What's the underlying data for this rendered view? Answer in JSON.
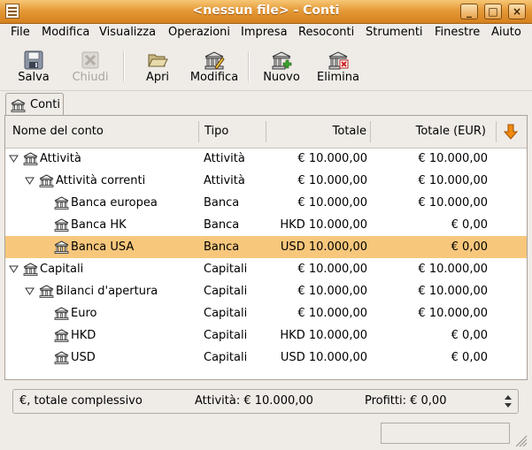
{
  "window": {
    "title": "<nessun file> - Conti",
    "controls": [
      "_",
      "□",
      "×"
    ]
  },
  "menubar": {
    "items": [
      "File",
      "Modifica",
      "Visualizza",
      "Operazioni",
      "Impresa",
      "Resoconti",
      "Strumenti",
      "Finestre",
      "Aiuto"
    ]
  },
  "toolbar": {
    "salva": "Salva",
    "chiudi": "Chiudi",
    "apri": "Apri",
    "modifica": "Modifica",
    "nuovo": "Nuovo",
    "elimina": "Elimina"
  },
  "tab": {
    "label": "Conti"
  },
  "columns": {
    "name": "Nome del conto",
    "type": "Tipo",
    "total": "Totale",
    "total_eur": "Totale (EUR)"
  },
  "rows": [
    {
      "name": "Attività",
      "type": "Attività",
      "total": "€ 10.000,00",
      "total_eur": "€ 10.000,00",
      "expanded": true
    },
    {
      "name": "Attività correnti",
      "type": "Attività",
      "total": "€ 10.000,00",
      "total_eur": "€ 10.000,00",
      "expanded": true
    },
    {
      "name": "Banca europea",
      "type": "Banca",
      "total": "€ 10.000,00",
      "total_eur": "€ 10.000,00"
    },
    {
      "name": "Banca HK",
      "type": "Banca",
      "total": "HKD 10.000,00",
      "total_eur": "€ 0,00"
    },
    {
      "name": "Banca USA",
      "type": "Banca",
      "total": "USD 10.000,00",
      "total_eur": "€ 0,00",
      "selected": true
    },
    {
      "name": "Capitali",
      "type": "Capitali",
      "total": "€ 10.000,00",
      "total_eur": "€ 10.000,00",
      "expanded": true
    },
    {
      "name": "Bilanci d'apertura",
      "type": "Capitali",
      "total": "€ 10.000,00",
      "total_eur": "€ 10.000,00",
      "expanded": true
    },
    {
      "name": "Euro",
      "type": "Capitali",
      "total": "€ 10.000,00",
      "total_eur": "€ 10.000,00"
    },
    {
      "name": "HKD",
      "type": "Capitali",
      "total": "HKD 10.000,00",
      "total_eur": "€ 0,00"
    },
    {
      "name": "USD",
      "type": "Capitali",
      "total": "USD 10.000,00",
      "total_eur": "€ 0,00"
    }
  ],
  "summary": {
    "currency": "€, totale complessivo",
    "assets": "Attività: € 10.000,00",
    "profits": "Profitti: € 0,00"
  },
  "colors": {
    "titlebar": "#e59a38",
    "selected_row": "#f7c77c",
    "column_picker_arrow": "#f08a10"
  }
}
